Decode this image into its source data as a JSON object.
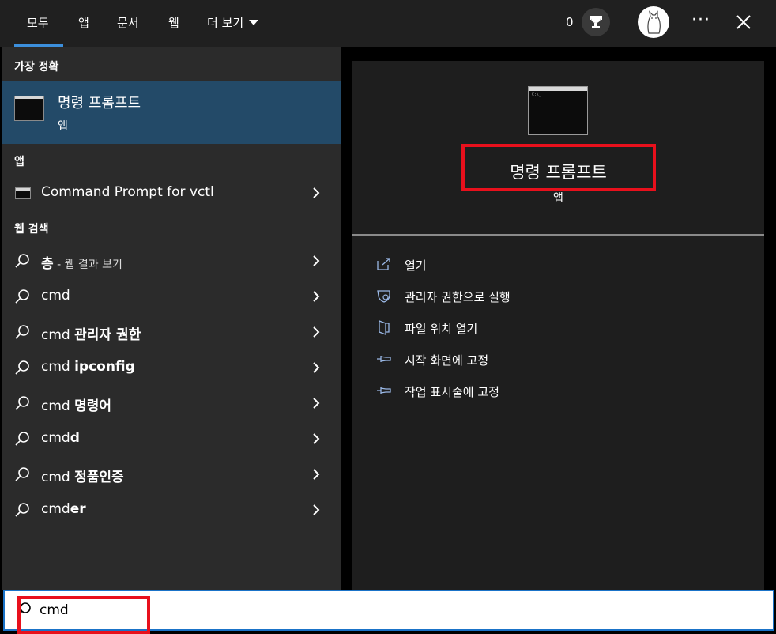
{
  "tabs": [
    {
      "label": "모두"
    },
    {
      "label": "앱"
    },
    {
      "label": "문서"
    },
    {
      "label": "웹"
    },
    {
      "label": "더 보기"
    }
  ],
  "header": {
    "points": "0"
  },
  "left": {
    "best_match_header": "가장 정확",
    "best_match": {
      "title": "명령 프롬프트",
      "subtitle": "앱"
    },
    "apps_header": "앱",
    "app_items": [
      {
        "label": "Command Prompt for vctl"
      }
    ],
    "web_header": "웹 검색",
    "web_items": [
      {
        "bold": "층",
        "suffix": " - 웹 결과 보기"
      },
      {
        "prefix": "cmd",
        "bold": ""
      },
      {
        "prefix": "cmd ",
        "bold": "관리자 권한"
      },
      {
        "prefix": "cmd ",
        "bold": "ipconfig"
      },
      {
        "prefix": "cmd ",
        "bold": "명령어"
      },
      {
        "prefix": "cmd",
        "bold": "d"
      },
      {
        "prefix": "cmd ",
        "bold": "정품인증"
      },
      {
        "prefix": "cmd",
        "bold": "er"
      }
    ]
  },
  "preview": {
    "title": "명령 프롬프트",
    "subtitle": "앱",
    "actions": [
      {
        "label": "열기",
        "icon": "open-icon"
      },
      {
        "label": "관리자 권한으로 실행",
        "icon": "shield-icon"
      },
      {
        "label": "파일 위치 열기",
        "icon": "folder-icon"
      },
      {
        "label": "시작 화면에 고정",
        "icon": "pin-icon"
      },
      {
        "label": "작업 표시줄에 고정",
        "icon": "pin-icon"
      }
    ]
  },
  "search": {
    "value": "cmd"
  },
  "colors": {
    "accent": "#3c8fdc",
    "selected": "#234a68",
    "highlight": "#e8101c"
  }
}
